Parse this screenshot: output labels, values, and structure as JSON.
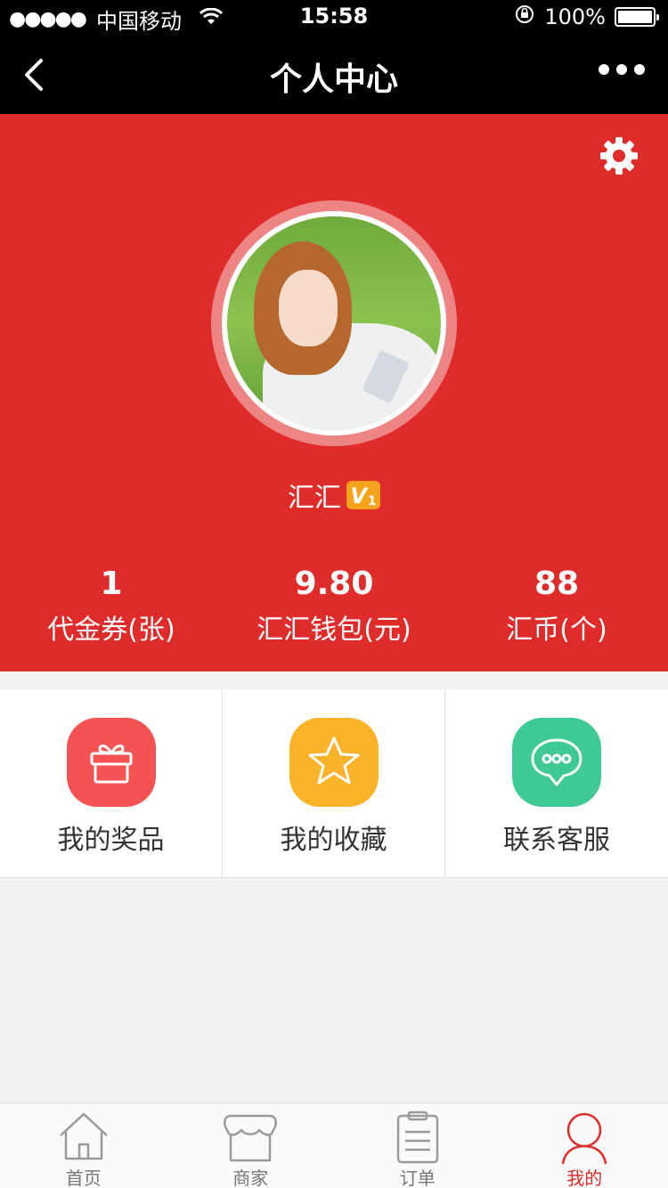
{
  "status_bar": {
    "signal": "●●●●●",
    "carrier": "中国移动",
    "time": "15:58",
    "battery": "100%"
  },
  "nav": {
    "title": "个人中心"
  },
  "profile": {
    "username": "汇汇",
    "vip_level": "V",
    "vip_level_num": "1",
    "stats": [
      {
        "value": "1",
        "label": "代金券(张)"
      },
      {
        "value": "9.80",
        "label": "汇汇钱包(元)"
      },
      {
        "value": "88",
        "label": "汇币(个)"
      }
    ]
  },
  "menu": [
    {
      "label": "我的奖品",
      "icon": "gift-icon",
      "color": "#f55353"
    },
    {
      "label": "我的收藏",
      "icon": "star-icon",
      "color": "#fbb32a"
    },
    {
      "label": "联系客服",
      "icon": "chat-bubble-icon",
      "color": "#3ec995"
    }
  ],
  "tab_bar": [
    {
      "label": "首页",
      "icon": "home-icon",
      "active": false
    },
    {
      "label": "商家",
      "icon": "store-icon",
      "active": false
    },
    {
      "label": "订单",
      "icon": "clipboard-icon",
      "active": false
    },
    {
      "label": "我的",
      "icon": "user-icon",
      "active": true
    }
  ],
  "colors": {
    "brand_red": "#e02b2b",
    "nav_black": "#000000"
  }
}
